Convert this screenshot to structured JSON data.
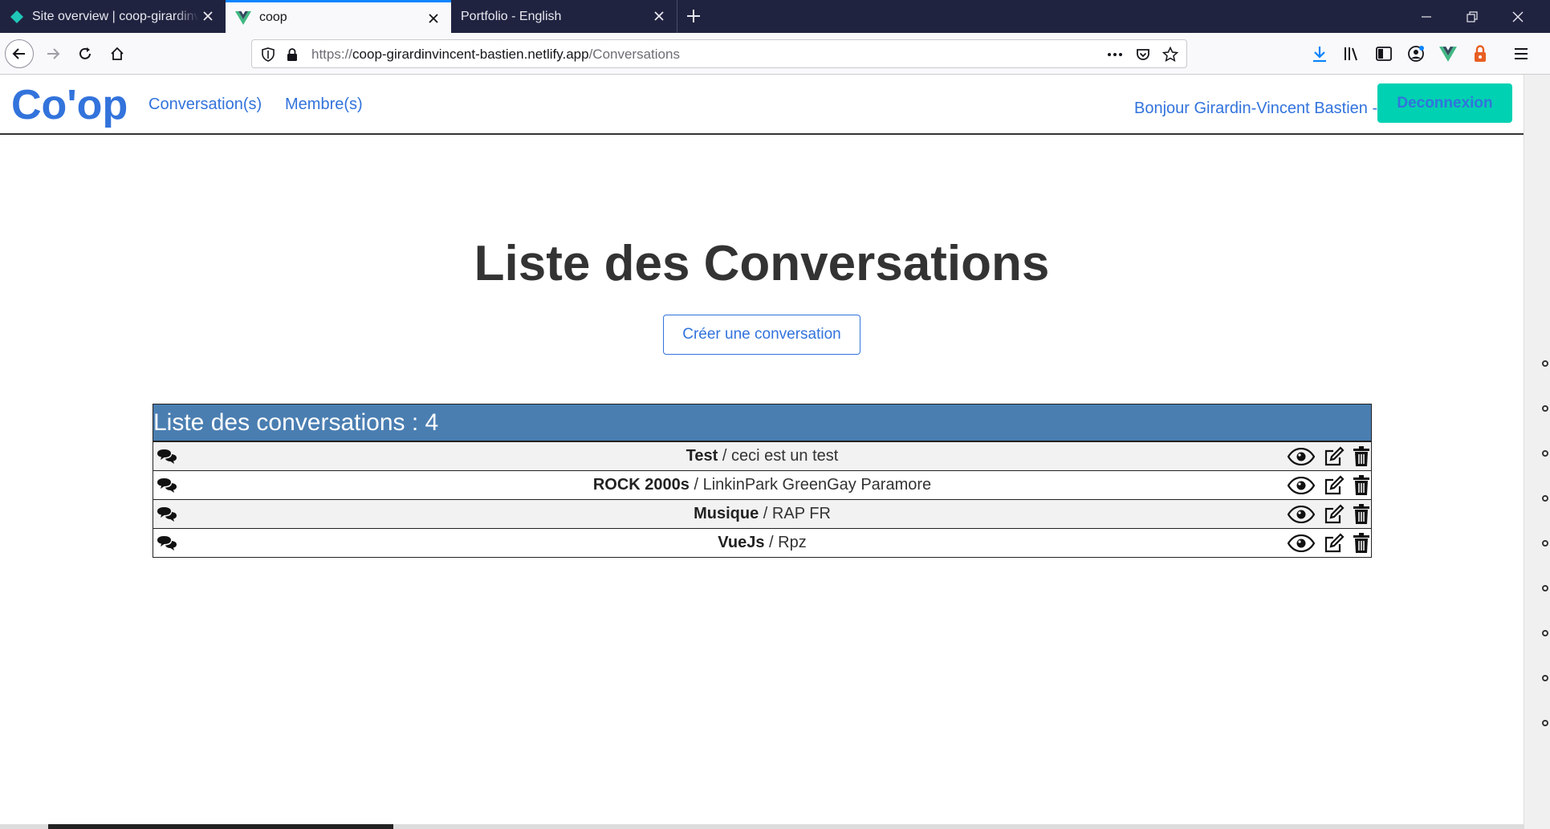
{
  "browser": {
    "tabs": [
      {
        "label": "Site overview | coop-girardinvincent-bastien",
        "icon": "netlify-diamond-icon"
      },
      {
        "label": "coop",
        "icon": "vue-logo-icon"
      },
      {
        "label": "Portfolio - English",
        "icon": ""
      }
    ],
    "url": {
      "prefix": "https://",
      "host": "coop-girardinvincent-bastien.netlify.app",
      "path": "/Conversations"
    }
  },
  "site": {
    "brand": "Co'op",
    "nav": {
      "conversations": "Conversation(s)",
      "members": "Membre(s)"
    },
    "greeting": "Bonjour Girardin-Vincent Bastien -",
    "logout_label": "Deconnexion"
  },
  "main": {
    "title": "Liste des Conversations",
    "create_label": "Créer une conversation",
    "list_header": "Liste des conversations : 4",
    "conversations": [
      {
        "title": "Test",
        "topic": " / ceci est un test"
      },
      {
        "title": "ROCK 2000s",
        "topic": " / LinkinPark GreenGay Paramore"
      },
      {
        "title": "Musique",
        "topic": " / RAP FR"
      },
      {
        "title": "VueJs",
        "topic": " / Rpz"
      }
    ]
  },
  "colors": {
    "brand": "#3273dc",
    "logout_bg": "#00d1b2",
    "table_header": "#4a7eb1",
    "tab_strip": "#202340"
  }
}
